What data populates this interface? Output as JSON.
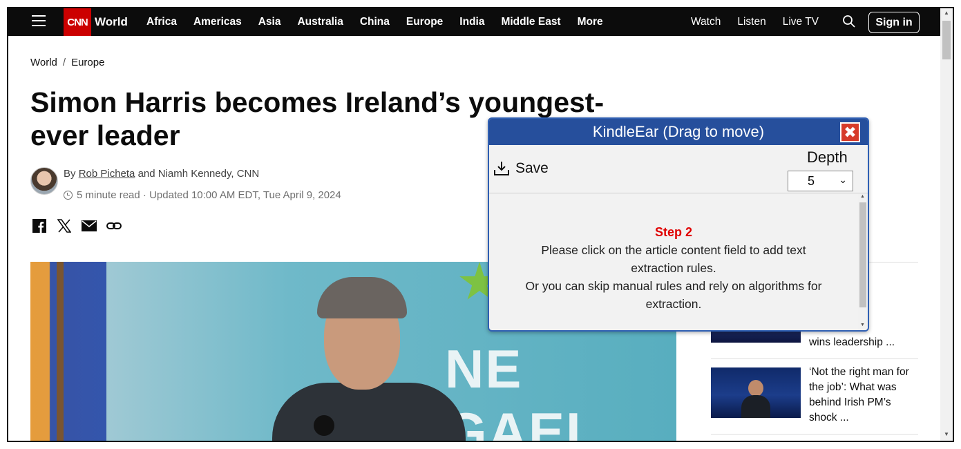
{
  "nav": {
    "section": "World",
    "logo": "CNN",
    "links": [
      "Africa",
      "Americas",
      "Asia",
      "Australia",
      "China",
      "Europe",
      "India",
      "Middle East",
      "More"
    ],
    "right_links": [
      "Watch",
      "Listen",
      "Live TV"
    ],
    "sign_in": "Sign in"
  },
  "breadcrumb": [
    "World",
    "Europe"
  ],
  "article": {
    "headline": "Simon Harris becomes Ireland’s youngest-ever leader",
    "byline_prefix": "By ",
    "author1": "Rob Picheta",
    "author_rest": " and Niamh Kennedy, CNN",
    "read_time": "5 minute read",
    "updated": "· Updated 10:00 AM EDT, Tue April 9, 2024",
    "hero_text": "NE GAEL"
  },
  "sidebar": {
    "items": [
      {
        "text": "for\never PM\nn Harris\nwins leadership ..."
      },
      {
        "text": "‘Not the right man for the job’: What was behind Irish PM’s shock ..."
      }
    ]
  },
  "kindleear": {
    "title": "KindleEar (Drag to move)",
    "close": "✖",
    "save": "Save",
    "depth_label": "Depth",
    "depth_value": "5",
    "step": "Step 2",
    "line1": "Please click on the article content field to add text extraction rules.",
    "line2": "Or you can skip manual rules and rely on algorithms for extraction."
  },
  "colors": {
    "cnn_red": "#cc0000",
    "kindleear_header": "#264f9c",
    "step_red": "#e00000"
  }
}
